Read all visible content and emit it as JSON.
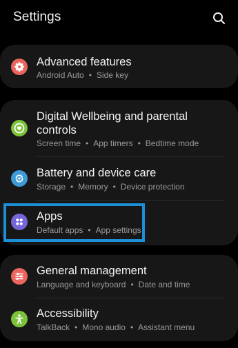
{
  "header": {
    "title": "Settings",
    "search_icon": "search-icon"
  },
  "cards": [
    {
      "items": [
        {
          "label": "Advanced features",
          "subs": [
            "Android Auto",
            "Side key"
          ],
          "icon": "gear-flower-icon",
          "icon_color": "#e9655d"
        }
      ]
    },
    {
      "items": [
        {
          "label_line1": "Digital Wellbeing and parental",
          "label_line2": "controls",
          "subs": [
            "Screen time",
            "App timers",
            "Bedtime mode"
          ],
          "icon": "wellbeing-heart-icon",
          "icon_color": "#7cc23b"
        },
        {
          "label": "Battery and device care",
          "subs": [
            "Storage",
            "Memory",
            "Device protection"
          ],
          "icon": "device-care-icon",
          "icon_color": "#3f9ad8"
        },
        {
          "label": "Apps",
          "subs": [
            "Default apps",
            "App settings"
          ],
          "icon": "apps-grid-icon",
          "icon_color": "#7466d9"
        }
      ]
    },
    {
      "items": [
        {
          "label": "General management",
          "subs": [
            "Language and keyboard",
            "Date and time"
          ],
          "icon": "sliders-icon",
          "icon_color": "#e9655d"
        },
        {
          "label": "Accessibility",
          "subs": [
            "TalkBack",
            "Mono audio",
            "Assistant menu"
          ],
          "icon": "accessibility-person-icon",
          "icon_color": "#7cc23b"
        }
      ]
    }
  ],
  "separator": "•",
  "highlight_color": "#1d8fd6"
}
